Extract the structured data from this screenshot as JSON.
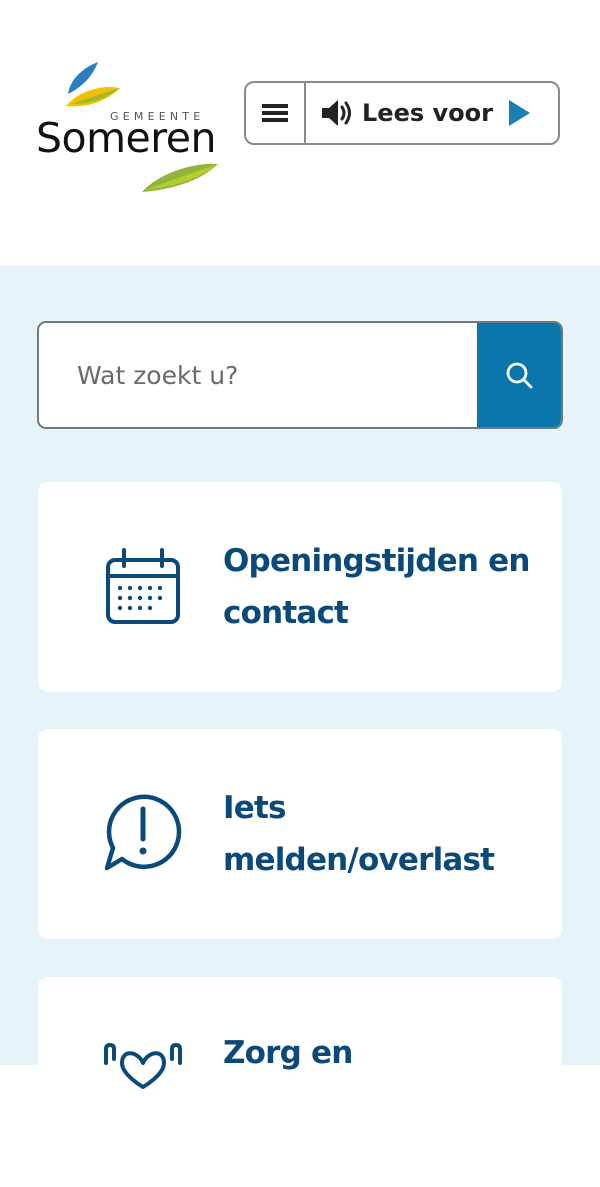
{
  "header": {
    "logo": {
      "top_text": "GEMEENTE",
      "name": "Someren",
      "colors": {
        "blue": "#2a7fc1",
        "yellow": "#f2c200",
        "green": "#8fb53a"
      }
    },
    "toolbar": {
      "menu_icon": "hamburger-menu-icon",
      "read_aloud_label": "Lees voor",
      "speaker_icon": "speaker-icon",
      "play_icon": "play-icon",
      "play_color": "#1a7fb5"
    }
  },
  "search": {
    "placeholder": "Wat zoekt u?",
    "button_icon": "search-icon",
    "button_color": "#0b76ab"
  },
  "cards": [
    {
      "label": "Openingstijden en contact",
      "icon": "calendar-icon"
    },
    {
      "label": "Iets melden/overlast",
      "icon": "alert-speech-icon"
    },
    {
      "label": "Zorg en",
      "icon": "hands-heart-icon"
    }
  ],
  "colors": {
    "background": "#e6f3f9",
    "card_text": "#0b4a78",
    "card_bg": "#ffffff"
  }
}
